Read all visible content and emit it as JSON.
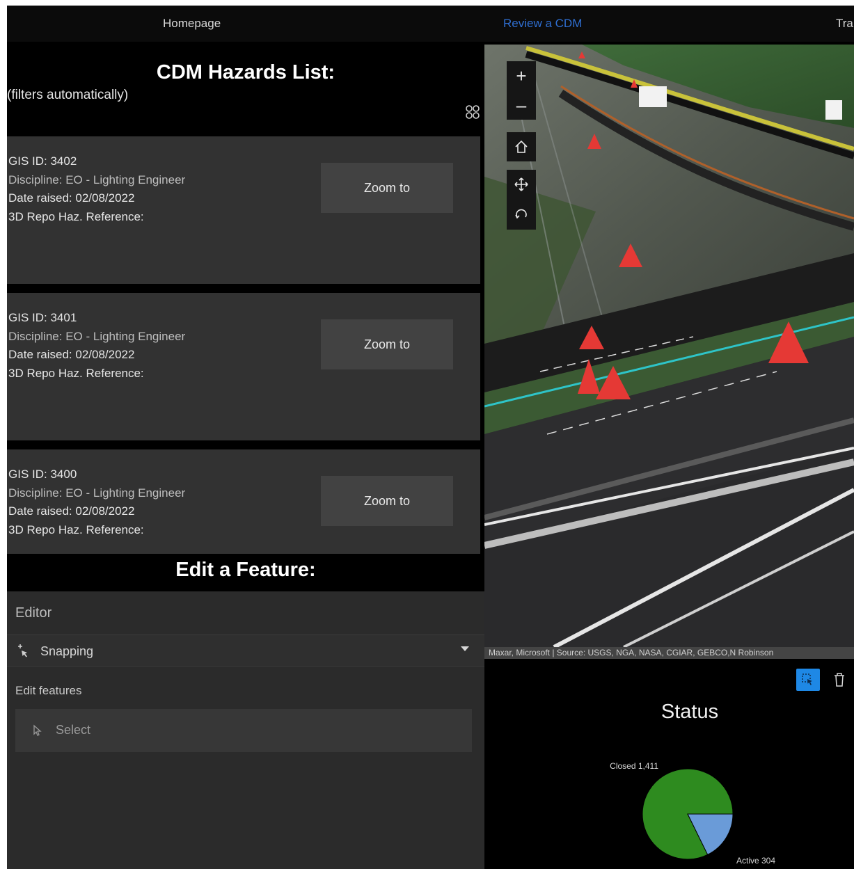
{
  "nav": {
    "items": [
      {
        "label": "Homepage",
        "active": false
      },
      {
        "label": "Review a CDM",
        "active": true
      },
      {
        "label": "Tra",
        "active": false
      }
    ]
  },
  "hazards": {
    "title": "CDM Hazards List:",
    "subtitle": "(filters automatically)",
    "view_icon": "grid-icon",
    "items": [
      {
        "gis": "GIS ID: 3402",
        "discipline": "Discipline: EO - Lighting Engineer",
        "date": "Date raised: 02/08/2022",
        "ref": "3D Repo Haz. Reference:",
        "button": "Zoom to"
      },
      {
        "gis": "GIS ID: 3401",
        "discipline": "Discipline: EO - Lighting Engineer",
        "date": "Date raised: 02/08/2022",
        "ref": "3D Repo Haz. Reference:",
        "button": "Zoom to"
      },
      {
        "gis": "GIS ID: 3400",
        "discipline": "Discipline: EO - Lighting Engineer",
        "date": "Date raised: 02/08/2022",
        "ref": "3D Repo Haz. Reference:",
        "button": "Zoom to"
      }
    ]
  },
  "edit": {
    "title": "Edit a Feature:",
    "editor_label": "Editor",
    "snapping_label": "Snapping",
    "edit_features_label": "Edit features",
    "select_label": "Select"
  },
  "map": {
    "controls": [
      "plus-icon",
      "minus-icon",
      "home-icon",
      "pan-icon",
      "rotate-icon"
    ],
    "attribution": "Maxar, Microsoft | Source: USGS, NGA, NASA, CGIAR, GEBCO,N Robinson"
  },
  "colors": {
    "closed": "#2e8b1f",
    "active": "#6a9bd8",
    "accent": "#1e88e5",
    "nav_active": "#2f6fd2"
  },
  "chart_data": {
    "type": "pie",
    "title": "Status",
    "slices": [
      {
        "label": "Closed",
        "value": 1411,
        "display": "Closed 1,411"
      },
      {
        "label": "Active",
        "value": 304,
        "display": "Active 304"
      }
    ]
  }
}
